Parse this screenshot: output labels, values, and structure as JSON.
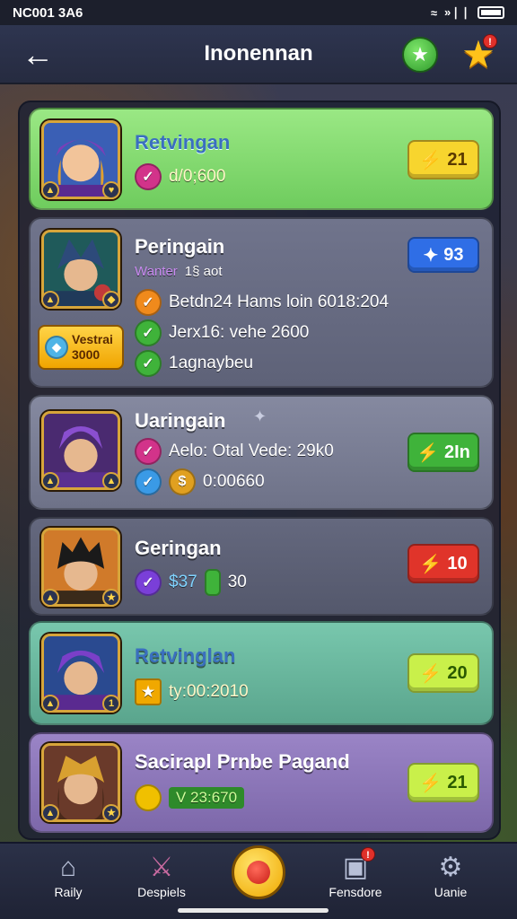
{
  "status_bar": {
    "time": "NC001 3A6",
    "signal": "»❘❘"
  },
  "header": {
    "title": "Inonennan"
  },
  "cards": [
    {
      "title": "Retvingan",
      "row1_text": "d/0;600",
      "button": "21",
      "bg": "#8fde7a",
      "button_color": "#f7d52e"
    },
    {
      "title": "Peringain",
      "subtitle_label": "Wanter",
      "subtitle_value": "1§ aot",
      "row1_text": "Betdn24 Hams loin 6018:204",
      "row2_text": "Jerx16: vehe 2600",
      "row3_text": "1agnaybeu",
      "side_badge_line1": "Vestrai",
      "side_badge_line2": "3000",
      "button": "93",
      "bg": "#6b6f86",
      "button_color": "#2f6ee6"
    },
    {
      "title": "Uaringain",
      "row1_text": "Aelo: Otal Vede: 29k0",
      "row2_text": "0:00660",
      "button": "2In",
      "bg": "#7a7e96",
      "button_color": "#3fb33a"
    },
    {
      "title": "Geringan",
      "row1_text": "$37",
      "row1_text2": "30",
      "button": "10",
      "bg": "#5c6078",
      "button_color": "#e0342a"
    },
    {
      "title": "Retvinglan",
      "row1_text": "ty:00:2010",
      "button": "20",
      "bg": "#6bb8a0",
      "button_color": "#c9f04a"
    },
    {
      "title": "Sacirapl Prnbe Pagand",
      "row1_text": "V 23:670",
      "button": "21",
      "bg": "#8d78b8",
      "button_color": "#c9f04a"
    }
  ],
  "nav": [
    {
      "label": "Raily"
    },
    {
      "label": "Despiels"
    },
    {
      "label": "Fensdore"
    },
    {
      "label": "Uanie"
    }
  ]
}
